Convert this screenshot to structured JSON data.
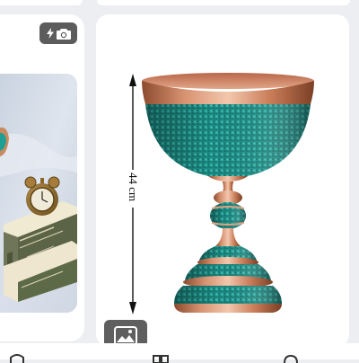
{
  "product": {
    "height_label": "44 cm"
  },
  "icons": {
    "left_card_badge": "flash-camera-icon",
    "right_card_badge": "image-gallery-icon",
    "nav": [
      "home-icon",
      "grid-icon",
      "search-icon"
    ]
  },
  "colors": {
    "page_bg": "#eceef1",
    "card_bg": "#ffffff",
    "badge_bg": "#5c5c5c",
    "turquoise": "#1f9f94",
    "copper": "#c77a56"
  }
}
